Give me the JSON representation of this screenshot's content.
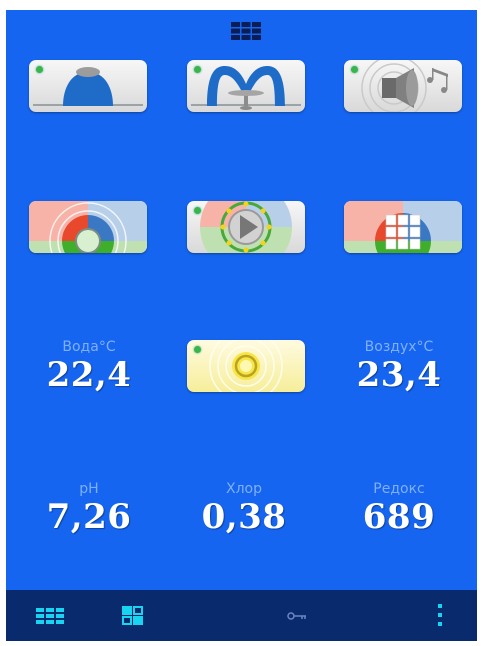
{
  "colors": {
    "background": "#1565f0",
    "bar": "#0a2a6e",
    "accent": "#18d4f0",
    "led": "#39b54a",
    "label": "#7fb0ff"
  },
  "top": {
    "icon": "grid-menu-icon"
  },
  "tiles": [
    {
      "name": "lamp-button",
      "icon": "pool-light-icon"
    },
    {
      "name": "fountain-button",
      "icon": "fountain-icon"
    },
    {
      "name": "speaker-button",
      "icon": "music-speaker-icon"
    },
    {
      "name": "color-mode-button",
      "icon": "color-wheel-icon"
    },
    {
      "name": "play-program-button",
      "icon": "play-icon"
    },
    {
      "name": "color-grid-button",
      "icon": "color-grid-icon"
    },
    {
      "name": "sun-light-button",
      "icon": "sun-icon"
    }
  ],
  "readouts": {
    "water": {
      "label": "Вода°С",
      "value": "22,4"
    },
    "air": {
      "label": "Воздух°С",
      "value": "23,4"
    },
    "ph": {
      "label": "pH",
      "value": "7,26"
    },
    "chlorine": {
      "label": "Хлор",
      "value": "0,38"
    },
    "redox": {
      "label": "Редокс",
      "value": "689"
    }
  },
  "bottombar": {
    "items": [
      {
        "name": "grid-view-icon"
      },
      {
        "name": "tiles-view-icon"
      },
      {
        "name": "key-icon"
      },
      {
        "name": "more-vertical-icon"
      }
    ]
  }
}
